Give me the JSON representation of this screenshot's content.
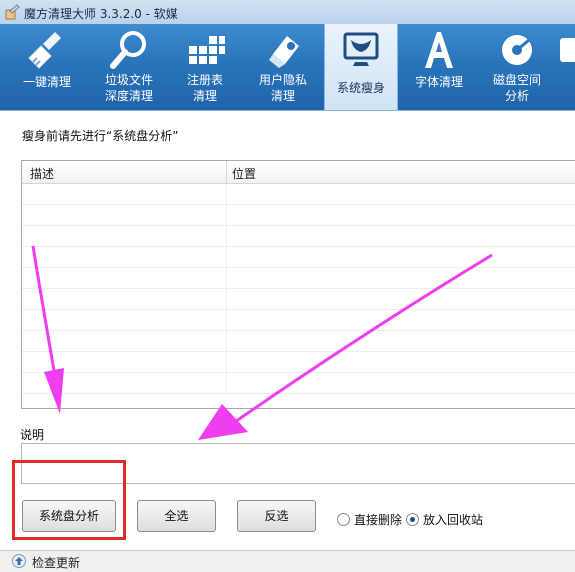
{
  "window": {
    "title": "魔方清理大师 3.3.2.0 - 软媒"
  },
  "toolbar": {
    "items": [
      {
        "label": "一键清理",
        "icon": "broom-icon"
      },
      {
        "label": "垃圾文件\n深度清理",
        "icon": "magnifier-icon"
      },
      {
        "label": "注册表\n清理",
        "icon": "registry-blocks-icon"
      },
      {
        "label": "用户隐私\n清理",
        "icon": "privacy-eraser-icon"
      },
      {
        "label": "系统瘦身",
        "icon": "monitor-icon",
        "active": true
      },
      {
        "label": "字体清理",
        "icon": "font-a-icon"
      },
      {
        "label": "磁盘空间\n分析",
        "icon": "disk-icon"
      }
    ]
  },
  "main": {
    "hint": "瘦身前请先进行“系统盘分析”",
    "list": {
      "columns": [
        "描述",
        "位置"
      ],
      "rows": []
    },
    "description_label": "说明",
    "description_value": ""
  },
  "actions": {
    "analyze_label": "系统盘分析",
    "select_all_label": "全选",
    "invert_label": "反选",
    "delete_options": [
      {
        "label": "直接删除",
        "selected": false
      },
      {
        "label": "放入回收站",
        "selected": true
      }
    ]
  },
  "statusbar": {
    "update_label": "检查更新"
  },
  "colors": {
    "toolbar_blue": "#2a74bc",
    "annotation_magenta": "#ee3ef0",
    "highlight_red": "#e22a2a"
  }
}
